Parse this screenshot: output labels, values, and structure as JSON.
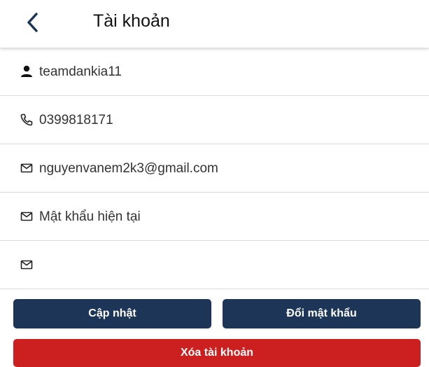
{
  "header": {
    "title": "Tài khoản"
  },
  "fields": [
    {
      "icon": "person-icon",
      "value": "teamdankia11",
      "placeholder": ""
    },
    {
      "icon": "phone-icon",
      "value": "0399818171",
      "placeholder": ""
    },
    {
      "icon": "mail-icon",
      "value": "nguyenvanem2k3@gmail.com",
      "placeholder": ""
    },
    {
      "icon": "mail-icon",
      "value": "",
      "placeholder": "Mật khẩu hiện tại"
    },
    {
      "icon": "mail-icon",
      "value": "",
      "placeholder": ""
    }
  ],
  "actions": {
    "update_label": "Cập nhật",
    "change_password_label": "Đổi mật khẩu",
    "delete_label": "Xóa tài khoản"
  },
  "colors": {
    "primary": "#1d3557",
    "danger": "#cc2020"
  }
}
